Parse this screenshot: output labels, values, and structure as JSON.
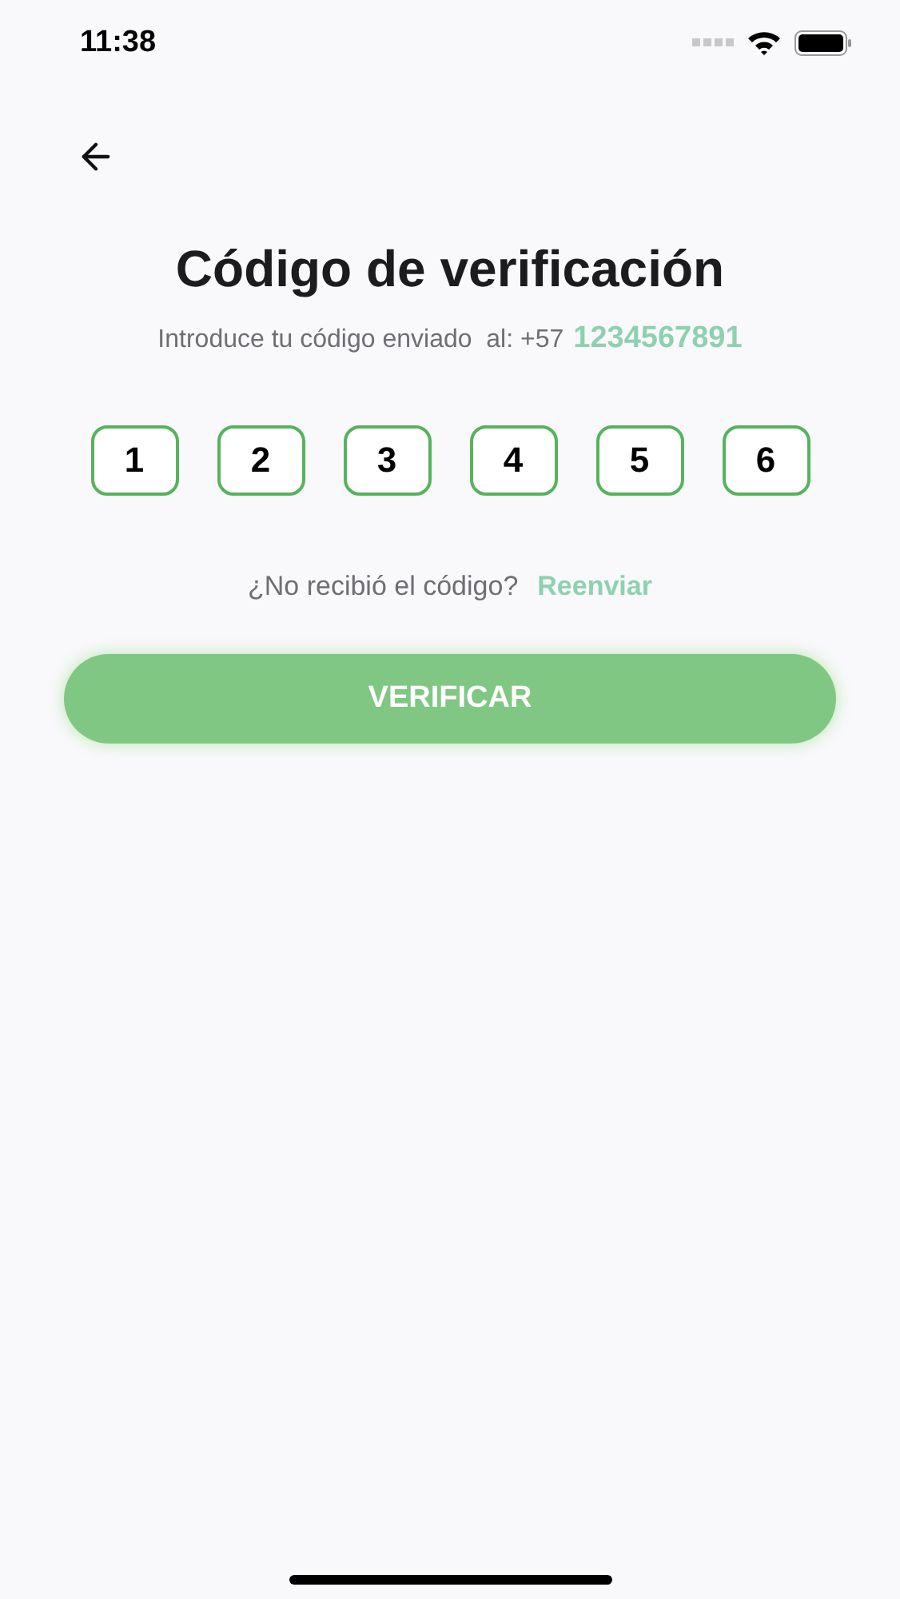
{
  "status_bar": {
    "time": "11:38"
  },
  "title": "Código de verificación",
  "subtitle": {
    "text": "Introduce tu código enviado  al: +57",
    "phone": "1234567891"
  },
  "code_digits": [
    "1",
    "2",
    "3",
    "4",
    "5",
    "6"
  ],
  "resend": {
    "question": "¿No recibió el código?",
    "link": "Reenviar"
  },
  "verify_button": "VERIFICAR"
}
